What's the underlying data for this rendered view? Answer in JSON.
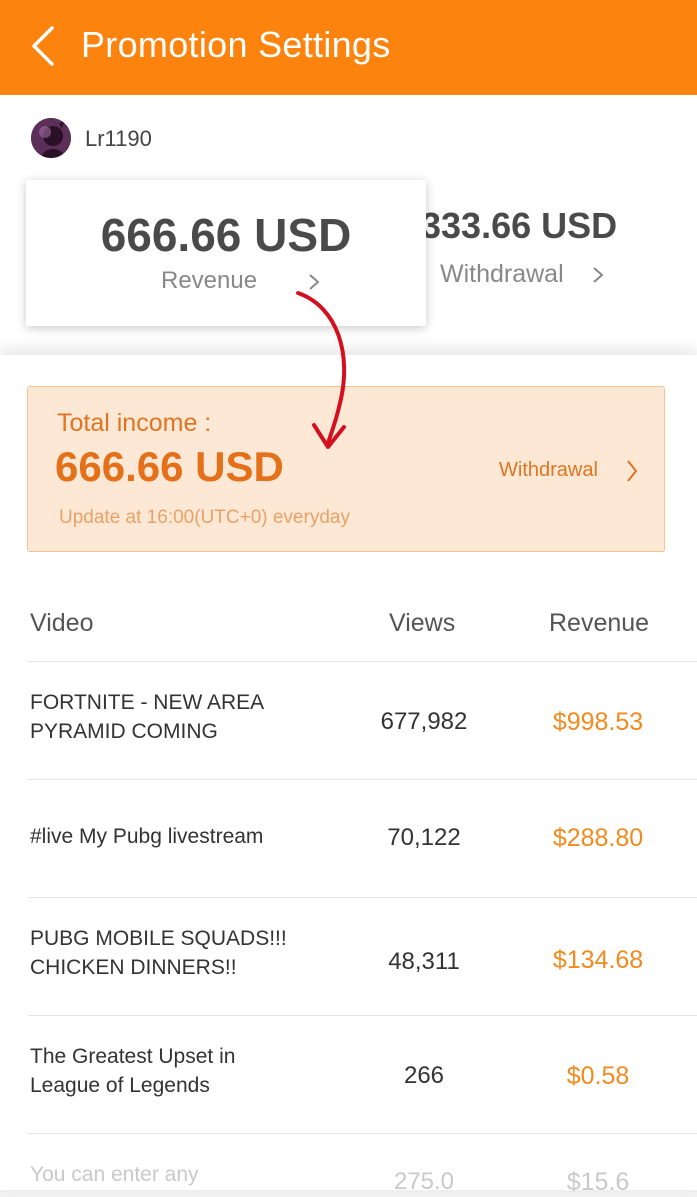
{
  "header": {
    "title": "Promotion Settings",
    "color": "#fb830e"
  },
  "profile": {
    "username": "Lr1190"
  },
  "revenue_card": {
    "amount": "666.66 USD",
    "label": "Revenue"
  },
  "withdrawal_card": {
    "amount": "333.66 USD",
    "label": "Withdrawal"
  },
  "income": {
    "label": "Total income :",
    "amount": "666.66 USD",
    "update_note": "Update at 16:00(UTC+0) everyday",
    "withdrawal_link": "Withdrawal"
  },
  "table": {
    "headers": [
      "Video",
      "Views",
      "Revenue"
    ],
    "rows": [
      {
        "video": "FORTNITE - NEW AREA PYRAMID COMING",
        "views": "677,982",
        "revenue": "$998.53"
      },
      {
        "video": "#live My Pubg livestream",
        "views": "70,122",
        "revenue": "$288.80"
      },
      {
        "video": "PUBG MOBILE SQUADS!!! CHICKEN DINNERS!!",
        "views": "48,311",
        "revenue": "$134.68"
      },
      {
        "video": "The Greatest Upset in League of Legends",
        "views": "266",
        "revenue": "$0.58"
      },
      {
        "video": "You can enter any",
        "views": "275.0",
        "revenue": "$15.6"
      }
    ]
  },
  "colors": {
    "accent": "#fb830e",
    "revenue_text": "#f28a1e",
    "annotation_arrow": "#d4101f"
  },
  "icons": {
    "back": "chevron-left-icon",
    "chevron": "chevron-right-icon",
    "annotation": "curved-arrow-icon"
  }
}
